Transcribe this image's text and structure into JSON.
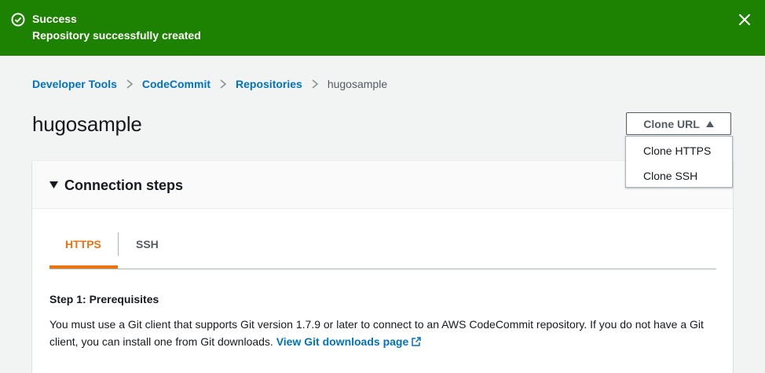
{
  "flash": {
    "title": "Success",
    "message": "Repository successfully created",
    "color": "#1d8102"
  },
  "breadcrumb": {
    "items": [
      "Developer Tools",
      "CodeCommit",
      "Repositories"
    ],
    "current": "hugosample"
  },
  "page": {
    "title": "hugosample"
  },
  "clone": {
    "button_label": "Clone URL",
    "options": [
      "Clone HTTPS",
      "Clone SSH"
    ]
  },
  "connection": {
    "title": "Connection steps",
    "tabs": [
      {
        "label": "HTTPS",
        "active": true
      },
      {
        "label": "SSH",
        "active": false
      }
    ],
    "step1_title": "Step 1: Prerequisites",
    "step1_text": "You must use a Git client that supports Git version 1.7.9 or later to connect to an AWS CodeCommit repository. If you do not have a Git client, you can install one from Git downloads.",
    "step1_link": "View Git downloads page"
  },
  "colors": {
    "link": "#0073bb",
    "accent": "#ec7211",
    "background": "#f2f3f3"
  }
}
